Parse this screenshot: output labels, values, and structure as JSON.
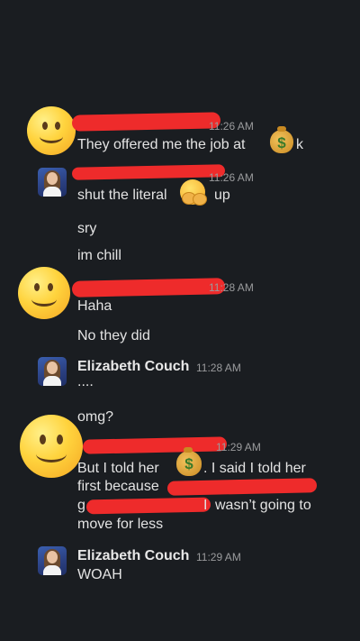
{
  "messages": [
    {
      "time": "11:26 AM",
      "lines": [
        "They offered me the job at",
        "k"
      ]
    },
    {
      "time": "11:26 AM",
      "lines": [
        "shut the literal",
        "up",
        "sry",
        "im chill"
      ]
    },
    {
      "time": "11:28 AM",
      "lines": [
        "Haha",
        "No they did"
      ]
    },
    {
      "sender": "Elizabeth Couch",
      "time": "11:28 AM",
      "lines": [
        "....",
        "omg?"
      ]
    },
    {
      "time": "11:29 AM",
      "lines": [
        "But I told her",
        ". I said I told her",
        "first because",
        "wasn’t going to",
        "move for less",
        "g",
        "I"
      ]
    },
    {
      "sender": "Elizabeth Couch",
      "time": "11:29 AM",
      "lines": [
        "WOAH"
      ]
    }
  ],
  "icons": {
    "money_bag": "$",
    "hug_face": "hugging-face-icon",
    "smiley": "smiley-face-icon"
  },
  "colors": {
    "background": "#1a1d21",
    "redaction": "#ee2b2b"
  }
}
